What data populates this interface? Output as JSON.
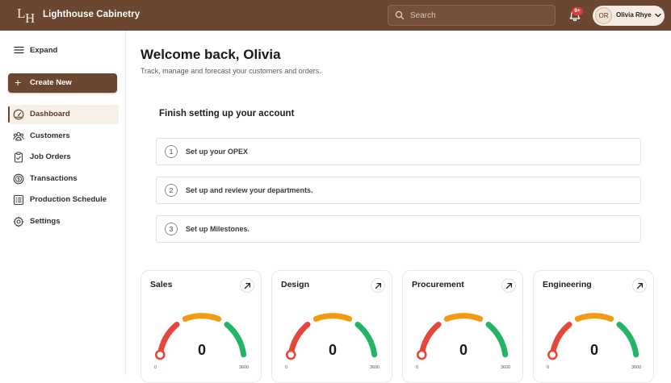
{
  "header": {
    "brand": "Lighthouse Cabinetry",
    "logo_letters": [
      "L",
      "H"
    ],
    "search_placeholder": "Search",
    "notification_badge": "9+",
    "user_initials": "OR",
    "user_name": "Olivia Rhye"
  },
  "sidebar": {
    "expand_label": "Expand",
    "create_label": "Create New",
    "items": [
      {
        "label": "Dashboard",
        "icon": "dashboard-gauge-icon",
        "active": true
      },
      {
        "label": "Customers",
        "icon": "customers-icon",
        "active": false
      },
      {
        "label": "Job Orders",
        "icon": "clipboard-icon",
        "active": false
      },
      {
        "label": "Transactions",
        "icon": "transactions-coin-icon",
        "active": false
      },
      {
        "label": "Production Schedule",
        "icon": "schedule-list-icon",
        "active": false
      },
      {
        "label": "Settings",
        "icon": "gear-icon",
        "active": false
      }
    ]
  },
  "main": {
    "title": "Welcome back, Olivia",
    "subtitle": "Track, manage and forecast your customers and orders.",
    "setup_title": "Finish setting up your account",
    "steps": [
      {
        "num": "1",
        "label": "Set up your OPEX"
      },
      {
        "num": "2",
        "label": "Set up and review your departments."
      },
      {
        "num": "3",
        "label": "Set up Milestones."
      }
    ],
    "cards": [
      {
        "title": "Sales",
        "value": "0",
        "min": "0",
        "max": "3600"
      },
      {
        "title": "Design",
        "value": "0",
        "min": "0",
        "max": "3600"
      },
      {
        "title": "Procurement",
        "value": "0",
        "min": "0",
        "max": "3600"
      },
      {
        "title": "Engineering",
        "value": "0",
        "min": "0",
        "max": "3600"
      }
    ]
  },
  "colors": {
    "brand_brown": "#6b4731",
    "gauge_red": "#e5473a",
    "gauge_orange": "#f29a12",
    "gauge_green": "#22b566",
    "badge_red": "#e23b3b"
  }
}
